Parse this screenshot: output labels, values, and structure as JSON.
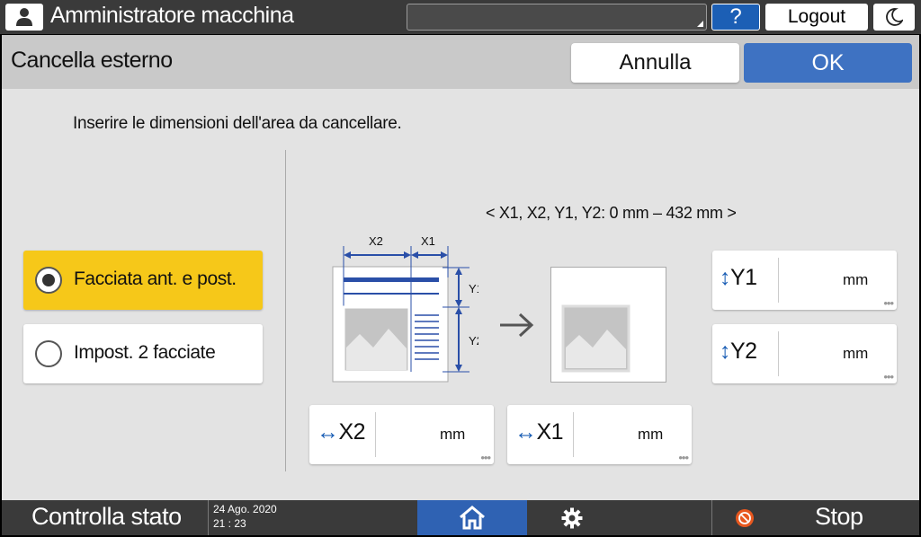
{
  "topbar": {
    "title": "Amministratore macchina",
    "help_label": "?",
    "logout_label": "Logout"
  },
  "header": {
    "title": "Cancella esterno",
    "cancel_label": "Annulla",
    "ok_label": "OK"
  },
  "content": {
    "instruction": "Inserire le dimensioni dell'area da cancellare.",
    "range_text": "< X1, X2, Y1, Y2: 0 mm – 432 mm >",
    "options": [
      {
        "label": "Facciata ant. e post.",
        "selected": true
      },
      {
        "label": "Impost. 2 facciate",
        "selected": false
      }
    ],
    "diagram": {
      "x2": "X2",
      "x1": "X1",
      "y1": "Y1",
      "y2": "Y2"
    },
    "fields": {
      "y1": {
        "icon": "↕",
        "label": "Y1",
        "unit": "mm"
      },
      "y2": {
        "icon": "↕",
        "label": "Y2",
        "unit": "mm"
      },
      "x2": {
        "icon": "↔",
        "label": "X2",
        "unit": "mm"
      },
      "x1": {
        "icon": "↔",
        "label": "X1",
        "unit": "mm"
      }
    }
  },
  "bottombar": {
    "status_label": "Controlla stato",
    "date": "24 Ago. 2020",
    "time": "21 : 23",
    "stop_label": "Stop"
  },
  "colors": {
    "accent_blue": "#3e72c2",
    "selected_yellow": "#f6c819",
    "diagram_blue": "#2a4fa8",
    "stop_orange": "#e8581f"
  }
}
